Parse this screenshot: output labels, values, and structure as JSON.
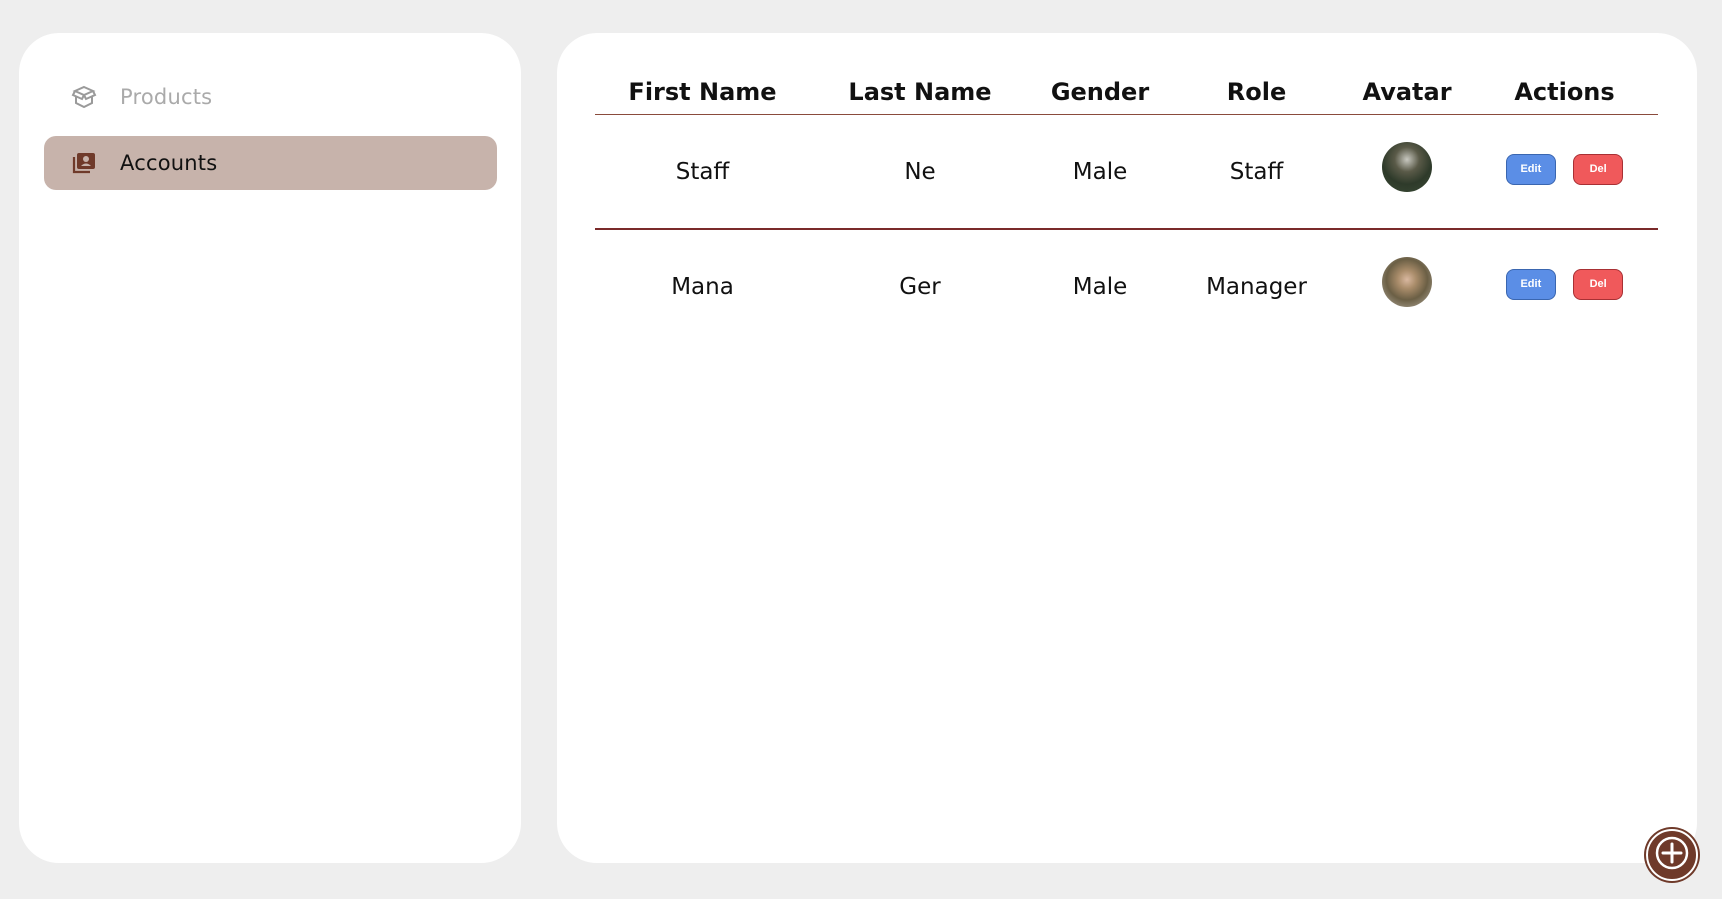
{
  "sidebar": {
    "items": [
      {
        "label": "Products",
        "icon": "box-icon",
        "active": false
      },
      {
        "label": "Accounts",
        "icon": "account-card-icon",
        "active": true
      }
    ]
  },
  "table": {
    "headers": [
      "First Name",
      "Last Name",
      "Gender",
      "Role",
      "Avatar",
      "Actions"
    ],
    "rows": [
      {
        "first_name": "Staff",
        "last_name": "Ne",
        "gender": "Male",
        "role": "Staff",
        "edit": "Edit",
        "del": "Del"
      },
      {
        "first_name": "Mana",
        "last_name": "Ger",
        "gender": "Male",
        "role": "Manager",
        "edit": "Edit",
        "del": "Del"
      }
    ]
  },
  "fab": {
    "icon": "plus-circle-icon"
  },
  "colors": {
    "accent": "#6f3a2a",
    "active_nav_bg": "#c7b3ab",
    "edit_button": "#5b8ee6",
    "delete_button": "#f0595b",
    "background": "#eeeeee"
  }
}
